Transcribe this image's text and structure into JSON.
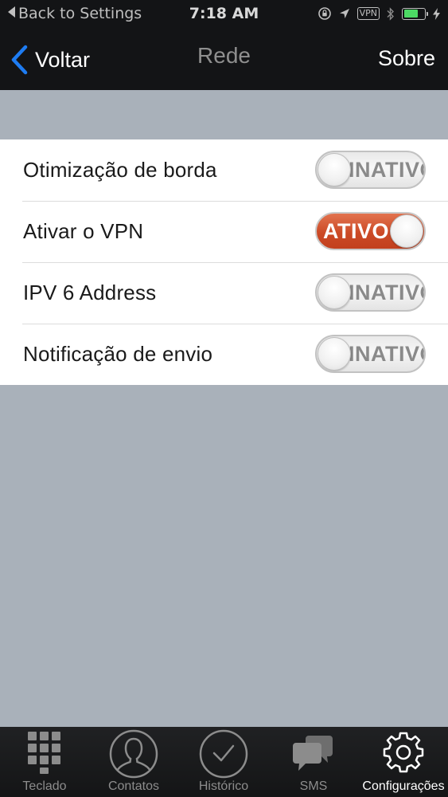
{
  "status_bar": {
    "back_app": "Back to Settings",
    "time": "7:18 AM",
    "vpn_badge": "VPN",
    "icons": [
      "back-triangle-icon",
      "rotation-lock-icon",
      "location-arrow-icon",
      "vpn-icon",
      "bluetooth-icon",
      "battery-icon",
      "charging-bolt-icon"
    ],
    "battery_level": 0.68,
    "battery_color": "#4cd964"
  },
  "nav": {
    "back_label": "Voltar",
    "title": "Rede",
    "right_label": "Sobre",
    "back_icon_color": "#1e7cf2"
  },
  "settings": {
    "rows": [
      {
        "label": "Otimização de borda",
        "state": "off",
        "toggle_text": "INATIVO"
      },
      {
        "label": "Ativar o VPN",
        "state": "on",
        "toggle_text": "ATIVO"
      },
      {
        "label": "IPV 6 Address",
        "state": "off",
        "toggle_text": "INATIVO"
      },
      {
        "label": "Notificação de envio",
        "state": "off",
        "toggle_text": "INATIVO"
      }
    ],
    "on_color": "#cc4a26"
  },
  "tab_bar": {
    "tabs": [
      {
        "label": "Teclado",
        "icon": "keypad-grid-icon",
        "active": false
      },
      {
        "label": "Contatos",
        "icon": "contact-person-icon",
        "active": false
      },
      {
        "label": "Histórico",
        "icon": "clock-history-icon",
        "active": false
      },
      {
        "label": "SMS",
        "icon": "chat-bubbles-icon",
        "active": false
      },
      {
        "label": "Configurações",
        "icon": "gear-icon",
        "active": true
      }
    ]
  }
}
